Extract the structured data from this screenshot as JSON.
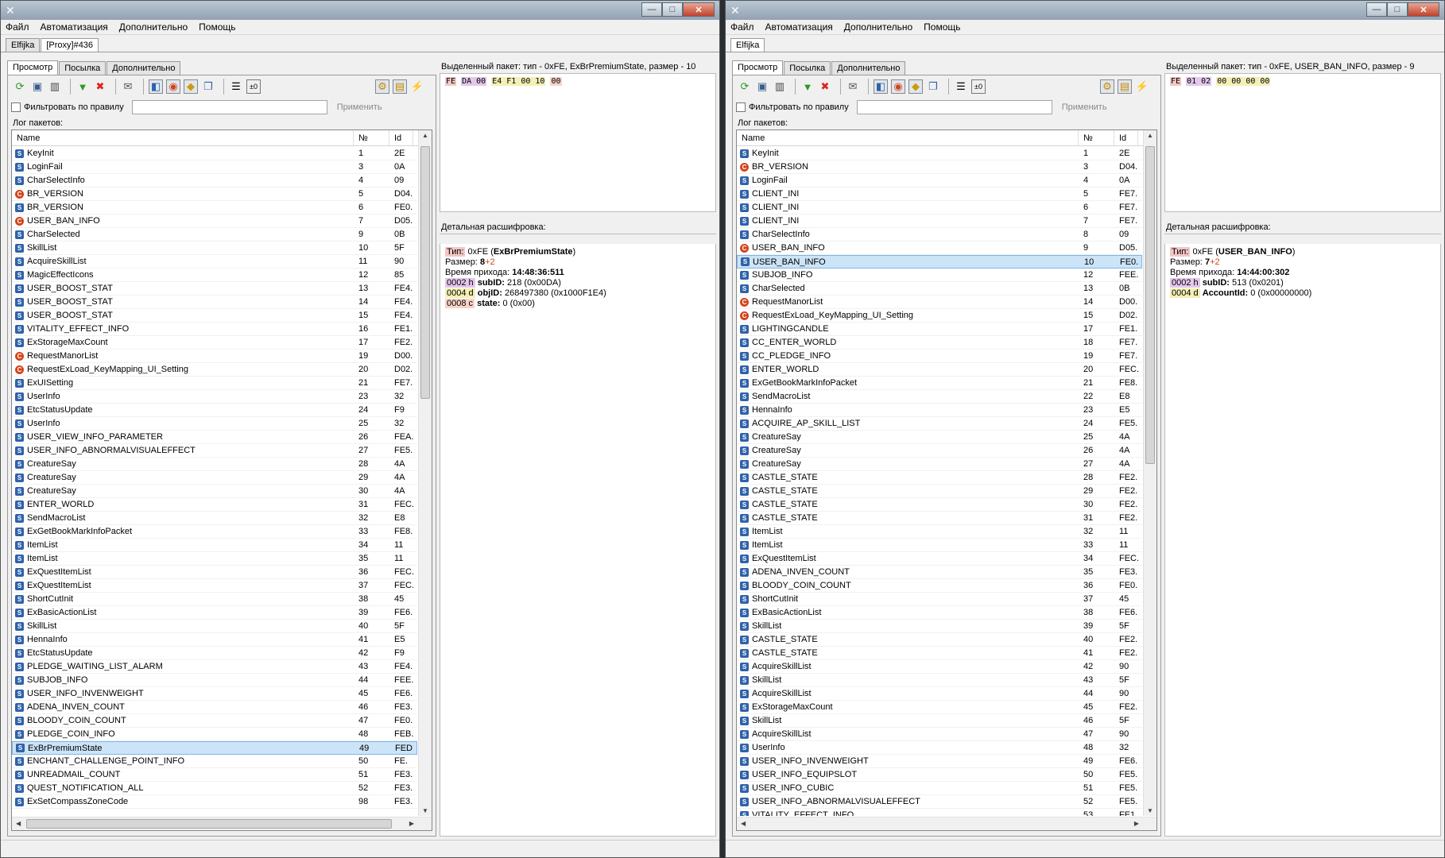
{
  "colors": {
    "titlebar": "#a7b6c4",
    "selection": "#cce4f7",
    "server_icon": "#2f62a9",
    "client_icon": "#d4441a"
  },
  "windows": [
    {
      "controls": {
        "minimize": "—",
        "maximize": "□",
        "close": "✕"
      },
      "menu": [
        "Файл",
        "Автоматизация",
        "Дополнительно",
        "Помощь"
      ],
      "conn_tabs": [
        {
          "label": "Elfijka",
          "active": false
        },
        {
          "label": "[Proxy]#436",
          "active": true
        }
      ],
      "sub_tabs": [
        {
          "label": "Просмотр",
          "active": true
        },
        {
          "label": "Посылка",
          "active": false
        },
        {
          "label": "Дополнительно",
          "active": false
        }
      ],
      "filter": {
        "label": "Фильтровать по правилу",
        "value": "",
        "apply": "Применить"
      },
      "log_label": "Лог пакетов:",
      "columns": [
        "Name",
        "№",
        "Id"
      ],
      "rows": [
        {
          "icon": "S",
          "name": "KeyInit",
          "num": "1",
          "id": "2E"
        },
        {
          "icon": "S",
          "name": "LoginFail",
          "num": "3",
          "id": "0A"
        },
        {
          "icon": "S",
          "name": "CharSelectInfo",
          "num": "4",
          "id": "09"
        },
        {
          "icon": "C",
          "name": "BR_VERSION",
          "num": "5",
          "id": "D04."
        },
        {
          "icon": "S",
          "name": "BR_VERSION",
          "num": "6",
          "id": "FE0."
        },
        {
          "icon": "C",
          "name": "USER_BAN_INFO",
          "num": "7",
          "id": "D05."
        },
        {
          "icon": "S",
          "name": "CharSelected",
          "num": "9",
          "id": "0B"
        },
        {
          "icon": "S",
          "name": "SkillList",
          "num": "10",
          "id": "5F"
        },
        {
          "icon": "S",
          "name": "AcquireSkillList",
          "num": "11",
          "id": "90"
        },
        {
          "icon": "S",
          "name": "MagicEffectIcons",
          "num": "12",
          "id": "85"
        },
        {
          "icon": "S",
          "name": "USER_BOOST_STAT",
          "num": "13",
          "id": "FE4."
        },
        {
          "icon": "S",
          "name": "USER_BOOST_STAT",
          "num": "14",
          "id": "FE4."
        },
        {
          "icon": "S",
          "name": "USER_BOOST_STAT",
          "num": "15",
          "id": "FE4."
        },
        {
          "icon": "S",
          "name": "VITALITY_EFFECT_INFO",
          "num": "16",
          "id": "FE1."
        },
        {
          "icon": "S",
          "name": "ExStorageMaxCount",
          "num": "17",
          "id": "FE2."
        },
        {
          "icon": "C",
          "name": "RequestManorList",
          "num": "19",
          "id": "D00."
        },
        {
          "icon": "C",
          "name": "RequestExLoad_KeyMapping_UI_Setting",
          "num": "20",
          "id": "D02."
        },
        {
          "icon": "S",
          "name": "ExUISetting",
          "num": "21",
          "id": "FE7."
        },
        {
          "icon": "S",
          "name": "UserInfo",
          "num": "23",
          "id": "32"
        },
        {
          "icon": "S",
          "name": "EtcStatusUpdate",
          "num": "24",
          "id": "F9"
        },
        {
          "icon": "S",
          "name": "UserInfo",
          "num": "25",
          "id": "32"
        },
        {
          "icon": "S",
          "name": "USER_VIEW_INFO_PARAMETER",
          "num": "26",
          "id": "FEA."
        },
        {
          "icon": "S",
          "name": "USER_INFO_ABNORMALVISUALEFFECT",
          "num": "27",
          "id": "FE5."
        },
        {
          "icon": "S",
          "name": "CreatureSay",
          "num": "28",
          "id": "4A"
        },
        {
          "icon": "S",
          "name": "CreatureSay",
          "num": "29",
          "id": "4A"
        },
        {
          "icon": "S",
          "name": "CreatureSay",
          "num": "30",
          "id": "4A"
        },
        {
          "icon": "S",
          "name": "ENTER_WORLD",
          "num": "31",
          "id": "FEC."
        },
        {
          "icon": "S",
          "name": "SendMacroList",
          "num": "32",
          "id": "E8"
        },
        {
          "icon": "S",
          "name": "ExGetBookMarkInfoPacket",
          "num": "33",
          "id": "FE8."
        },
        {
          "icon": "S",
          "name": "ItemList",
          "num": "34",
          "id": "11"
        },
        {
          "icon": "S",
          "name": "ItemList",
          "num": "35",
          "id": "11"
        },
        {
          "icon": "S",
          "name": "ExQuestItemList",
          "num": "36",
          "id": "FEC."
        },
        {
          "icon": "S",
          "name": "ExQuestItemList",
          "num": "37",
          "id": "FEC."
        },
        {
          "icon": "S",
          "name": "ShortCutInit",
          "num": "38",
          "id": "45"
        },
        {
          "icon": "S",
          "name": "ExBasicActionList",
          "num": "39",
          "id": "FE6."
        },
        {
          "icon": "S",
          "name": "SkillList",
          "num": "40",
          "id": "5F"
        },
        {
          "icon": "S",
          "name": "HennaInfo",
          "num": "41",
          "id": "E5"
        },
        {
          "icon": "S",
          "name": "EtcStatusUpdate",
          "num": "42",
          "id": "F9"
        },
        {
          "icon": "S",
          "name": "PLEDGE_WAITING_LIST_ALARM",
          "num": "43",
          "id": "FE4."
        },
        {
          "icon": "S",
          "name": "SUBJOB_INFO",
          "num": "44",
          "id": "FEE."
        },
        {
          "icon": "S",
          "name": "USER_INFO_INVENWEIGHT",
          "num": "45",
          "id": "FE6."
        },
        {
          "icon": "S",
          "name": "ADENA_INVEN_COUNT",
          "num": "46",
          "id": "FE3."
        },
        {
          "icon": "S",
          "name": "BLOODY_COIN_COUNT",
          "num": "47",
          "id": "FE0."
        },
        {
          "icon": "S",
          "name": "PLEDGE_COIN_INFO",
          "num": "48",
          "id": "FEB."
        },
        {
          "icon": "S",
          "name": "ExBrPremiumState",
          "num": "49",
          "id": "FED",
          "selected": true
        },
        {
          "icon": "S",
          "name": "ENCHANT_CHALLENGE_POINT_INFO",
          "num": "50",
          "id": "FE."
        },
        {
          "icon": "S",
          "name": "UNREADMAIL_COUNT",
          "num": "51",
          "id": "FE3."
        },
        {
          "icon": "S",
          "name": "QUEST_NOTIFICATION_ALL",
          "num": "52",
          "id": "FE3."
        },
        {
          "icon": "S",
          "name": "ExSetCompassZoneCode",
          "num": "98",
          "id": "FE3."
        }
      ],
      "selected_title": "Выделенный пакет: тип - 0xFE, ExBrPremiumState, размер - 10",
      "hex": [
        {
          "b": "FE",
          "k": "t"
        },
        {
          "b": "DA 00",
          "k": "h"
        },
        {
          "b": "E4 F1 00 10",
          "k": "d"
        },
        {
          "b": "00",
          "k": "c"
        }
      ],
      "detail_title": "Детальная расшифровка:",
      "detail": {
        "type_label": "Тип:",
        "type_value": "0xFE",
        "type_name": "ExBrPremiumState",
        "size_label": "Размер:",
        "size_value": "8",
        "size_extra": "+2",
        "time_label": "Время прихода:",
        "time_value": "14:48:36:511",
        "fields": [
          {
            "offset": "0002 h",
            "k": "h",
            "name": "subID:",
            "value": "218 (0x00DA)"
          },
          {
            "offset": "0004 d",
            "k": "d",
            "name": "objID:",
            "value": "268497380 (0x1000F1E4)"
          },
          {
            "offset": "0008 c",
            "k": "c",
            "name": "state:",
            "value": "0 (0x00)"
          }
        ]
      }
    },
    {
      "controls": {
        "minimize": "—",
        "maximize": "□",
        "close": "✕"
      },
      "menu": [
        "Файл",
        "Автоматизация",
        "Дополнительно",
        "Помощь"
      ],
      "conn_tabs": [
        {
          "label": "Elfijka",
          "active": true
        }
      ],
      "sub_tabs": [
        {
          "label": "Просмотр",
          "active": true
        },
        {
          "label": "Посылка",
          "active": false
        },
        {
          "label": "Дополнительно",
          "active": false
        }
      ],
      "filter": {
        "label": "Фильтровать по правилу",
        "value": "",
        "apply": "Применить"
      },
      "log_label": "Лог пакетов:",
      "columns": [
        "Name",
        "№",
        "Id"
      ],
      "rows": [
        {
          "icon": "S",
          "name": "KeyInit",
          "num": "1",
          "id": "2E"
        },
        {
          "icon": "C",
          "name": "BR_VERSION",
          "num": "3",
          "id": "D04..."
        },
        {
          "icon": "S",
          "name": "LoginFail",
          "num": "4",
          "id": "0A"
        },
        {
          "icon": "S",
          "name": "CLIENT_INI",
          "num": "5",
          "id": "FE7..."
        },
        {
          "icon": "S",
          "name": "CLIENT_INI",
          "num": "6",
          "id": "FE7..."
        },
        {
          "icon": "S",
          "name": "CLIENT_INI",
          "num": "7",
          "id": "FE7..."
        },
        {
          "icon": "S",
          "name": "CharSelectInfo",
          "num": "8",
          "id": "09"
        },
        {
          "icon": "C",
          "name": "USER_BAN_INFO",
          "num": "9",
          "id": "D05..."
        },
        {
          "icon": "S",
          "name": "USER_BAN_INFO",
          "num": "10",
          "id": "FE0...",
          "selected": true
        },
        {
          "icon": "S",
          "name": "SUBJOB_INFO",
          "num": "12",
          "id": "FEE..."
        },
        {
          "icon": "S",
          "name": "CharSelected",
          "num": "13",
          "id": "0B"
        },
        {
          "icon": "C",
          "name": "RequestManorList",
          "num": "14",
          "id": "D00..."
        },
        {
          "icon": "C",
          "name": "RequestExLoad_KeyMapping_UI_Setting",
          "num": "15",
          "id": "D02..."
        },
        {
          "icon": "S",
          "name": "LIGHTINGCANDLE",
          "num": "17",
          "id": "FE1..."
        },
        {
          "icon": "S",
          "name": "CC_ENTER_WORLD",
          "num": "18",
          "id": "FE7..."
        },
        {
          "icon": "S",
          "name": "CC_PLEDGE_INFO",
          "num": "19",
          "id": "FE7..."
        },
        {
          "icon": "S",
          "name": "ENTER_WORLD",
          "num": "20",
          "id": "FEC..."
        },
        {
          "icon": "S",
          "name": "ExGetBookMarkInfoPacket",
          "num": "21",
          "id": "FE8..."
        },
        {
          "icon": "S",
          "name": "SendMacroList",
          "num": "22",
          "id": "E8"
        },
        {
          "icon": "S",
          "name": "HennaInfo",
          "num": "23",
          "id": "E5"
        },
        {
          "icon": "S",
          "name": "ACQUIRE_AP_SKILL_LIST",
          "num": "24",
          "id": "FE5..."
        },
        {
          "icon": "S",
          "name": "CreatureSay",
          "num": "25",
          "id": "4A"
        },
        {
          "icon": "S",
          "name": "CreatureSay",
          "num": "26",
          "id": "4A"
        },
        {
          "icon": "S",
          "name": "CreatureSay",
          "num": "27",
          "id": "4A"
        },
        {
          "icon": "S",
          "name": "CASTLE_STATE",
          "num": "28",
          "id": "FE2..."
        },
        {
          "icon": "S",
          "name": "CASTLE_STATE",
          "num": "29",
          "id": "FE2..."
        },
        {
          "icon": "S",
          "name": "CASTLE_STATE",
          "num": "30",
          "id": "FE2..."
        },
        {
          "icon": "S",
          "name": "CASTLE_STATE",
          "num": "31",
          "id": "FE2..."
        },
        {
          "icon": "S",
          "name": "ItemList",
          "num": "32",
          "id": "11"
        },
        {
          "icon": "S",
          "name": "ItemList",
          "num": "33",
          "id": "11"
        },
        {
          "icon": "S",
          "name": "ExQuestItemList",
          "num": "34",
          "id": "FEC..."
        },
        {
          "icon": "S",
          "name": "ADENA_INVEN_COUNT",
          "num": "35",
          "id": "FE3..."
        },
        {
          "icon": "S",
          "name": "BLOODY_COIN_COUNT",
          "num": "36",
          "id": "FE0..."
        },
        {
          "icon": "S",
          "name": "ShortCutInit",
          "num": "37",
          "id": "45"
        },
        {
          "icon": "S",
          "name": "ExBasicActionList",
          "num": "38",
          "id": "FE6..."
        },
        {
          "icon": "S",
          "name": "SkillList",
          "num": "39",
          "id": "5F"
        },
        {
          "icon": "S",
          "name": "CASTLE_STATE",
          "num": "40",
          "id": "FE2..."
        },
        {
          "icon": "S",
          "name": "CASTLE_STATE",
          "num": "41",
          "id": "FE2..."
        },
        {
          "icon": "S",
          "name": "AcquireSkillList",
          "num": "42",
          "id": "90"
        },
        {
          "icon": "S",
          "name": "SkillList",
          "num": "43",
          "id": "5F"
        },
        {
          "icon": "S",
          "name": "AcquireSkillList",
          "num": "44",
          "id": "90"
        },
        {
          "icon": "S",
          "name": "ExStorageMaxCount",
          "num": "45",
          "id": "FE2..."
        },
        {
          "icon": "S",
          "name": "SkillList",
          "num": "46",
          "id": "5F"
        },
        {
          "icon": "S",
          "name": "AcquireSkillList",
          "num": "47",
          "id": "90"
        },
        {
          "icon": "S",
          "name": "UserInfo",
          "num": "48",
          "id": "32"
        },
        {
          "icon": "S",
          "name": "USER_INFO_INVENWEIGHT",
          "num": "49",
          "id": "FE6..."
        },
        {
          "icon": "S",
          "name": "USER_INFO_EQUIPSLOT",
          "num": "50",
          "id": "FE5..."
        },
        {
          "icon": "S",
          "name": "USER_INFO_CUBIC",
          "num": "51",
          "id": "FE5..."
        },
        {
          "icon": "S",
          "name": "USER_INFO_ABNORMALVISUALEFFECT",
          "num": "52",
          "id": "FE5..."
        },
        {
          "icon": "S",
          "name": "VITALITY_EFFECT_INFO",
          "num": "53",
          "id": "FE1..."
        }
      ],
      "selected_title": "Выделенный пакет: тип - 0xFE, USER_BAN_INFO, размер - 9",
      "hex": [
        {
          "b": "FE",
          "k": "t"
        },
        {
          "b": "01 02",
          "k": "h"
        },
        {
          "b": "00 00 00 00",
          "k": "d"
        }
      ],
      "detail_title": "Детальная расшифровка:",
      "detail": {
        "type_label": "Тип:",
        "type_value": "0xFE",
        "type_name": "USER_BAN_INFO",
        "size_label": "Размер:",
        "size_value": "7",
        "size_extra": "+2",
        "time_label": "Время прихода:",
        "time_value": "14:44:00:302",
        "fields": [
          {
            "offset": "0002 h",
            "k": "h",
            "name": "subID:",
            "value": "513 (0x0201)"
          },
          {
            "offset": "0004 d",
            "k": "d",
            "name": "AccountId:",
            "value": "0 (0x00000000)"
          }
        ]
      }
    }
  ]
}
